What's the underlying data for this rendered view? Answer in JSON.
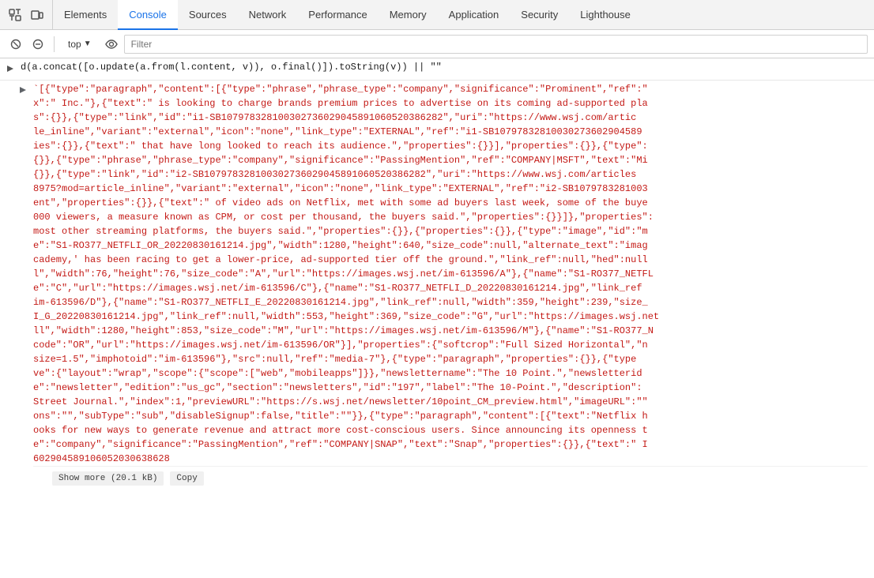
{
  "tabs": {
    "icon1_title": "inspect",
    "icon2_title": "device-toggle",
    "items": [
      {
        "id": "elements",
        "label": "Elements",
        "active": false
      },
      {
        "id": "console",
        "label": "Console",
        "active": true
      },
      {
        "id": "sources",
        "label": "Sources",
        "active": false
      },
      {
        "id": "network",
        "label": "Network",
        "active": false
      },
      {
        "id": "performance",
        "label": "Performance",
        "active": false
      },
      {
        "id": "memory",
        "label": "Memory",
        "active": false
      },
      {
        "id": "application",
        "label": "Application",
        "active": false
      },
      {
        "id": "security",
        "label": "Security",
        "active": false
      },
      {
        "id": "lighthouse",
        "label": "Lighthouse",
        "active": false
      }
    ]
  },
  "console_toolbar": {
    "context_label": "top",
    "filter_placeholder": "Filter"
  },
  "console": {
    "input_prompt": ">",
    "input_text": "d(a.concat([o.update(a.from(l.content, v)), o.final()]).toString(v)) || \"\"",
    "output_prompt": "<",
    "output_text": "`[{\"type\":\"paragraph\",\"content\":[{\"type\":\"phrase\",\"phrase_type\":\"company\",\"significance\":\"Prominent\",\"ref\":\"x\":\" Inc.\"},{\"text\":\" is looking to charge brands premium prices to advertise on its coming ad-supported pla s\":{}},{\"type\":\"link\",\"id\":\"i1-SB107978328100302736029045891060520386282\",\"uri\":\"https://www.wsj.com/artic le_inline\",\"variant\":\"external\",\"icon\":\"none\",\"link_type\":\"EXTERNAL\",\"ref\":\"i1-SB10797832810030273602904589 ies\":{}},{\"text\":\" that have long looked to reach its audience.\",\"properties\":{}}],\"properties\":{}},{\"type\": {}},{\"type\":\"phrase\",\"phrase_type\":\"company\",\"significance\":\"PassingMention\",\"ref\":\"COMPANY|MSFT\",\"text\":\"Mi {}},{\"type\":\"link\",\"id\":\"i2-SB107978328100302736029045891060520386282\",\"uri\":\"https://www.wsj.com/articles 8975?mod=article_inline\",\"variant\":\"external\",\"icon\":\"none\",\"link_type\":\"EXTERNAL\",\"ref\":\"i2-SB1079783281003 ent\",\"properties\":{}},{\"text\":\" of video ads on Netflix, met with some ad buyers last week, some of the buye 000 viewers, a measure known as CPM, or cost per thousand, the buyers said.\",\"properties\":{}}]},\"properties\": most other streaming platforms, the buyers said.\",\"properties\":{}},{\"properties\":{}},{\"type\":\"image\",\"id\":\"m e\":\"S1-RO377_NETFLI_OR_20220830161214.jpg\",\"width\":1280,\"height\":640,\"size_code\":null,\"alternate_text\":\"imag cademy,' has been racing to get a lower-price, ad-supported tier off the ground.\",\"link_ref\":null,\"hed\":null l\",\"width\":76,\"height\":76,\"size_code\":\"A\",\"url\":\"https://images.wsj.net/im-613596/A\"},{\"name\":\"S1-RO377_NETFL e\":\"C\",\"url\":\"https://images.wsj.net/im-613596/C\"},{\"name\":\"S1-RO377_NETFLI_D_20220830161214.jpg\",\"link_ref im-613596/D\"},{\"name\":\"S1-RO377_NETFLI_E_20220830161214.jpg\",\"link_ref\":null,\"width\":359,\"height\":239,\"size_ I_G_20220830161214.jpg\",\"link_ref\":null,\"width\":553,\"height\":369,\"size_code\":\"G\",\"url\":\"https://images.wsj.net ll\",\"width\":1280,\"height\":853,\"size_code\":\"M\",\"url\":\"https://images.wsj.net/im-613596/M\"},{\"name\":\"S1-RO377_N code\":\"OR\",\"url\":\"https://images.wsj.net/im-613596/OR\"}],\"properties\":{\"softcrop\":\"Full Sized Horizontal\",\"n size=1.5\",\"imphotoid\":\"im-613596\"},\"src\":null,\"ref\":\"media-7\"},{\"type\":\"paragraph\",\"properties\":{}},{\"type ve\":{\"layout\":\"wrap\",\"scope\":{\"scope\":[\"web\",\"mobileapps\"]}},\"newslettername\":\"The 10 Point.\",\"newsletterid e\":\"newsletter\",\"edition\":\"us_gc\",\"section\":\"newsletters\",\"id\":\"197\",\"label\":\"The 10-Point.\",\"description\": Street Journal.\",\"index\":1,\"previewURL\":\"https://s.wsj.net/newsletter/10point_CM_preview.html\",\"imageURL\":\"\" ons\":\"\",\"subType\":\"sub\",\"disableSignup\":false,\"title\":\"\"}},{\"type\":\"paragraph\",\"content\":[{\"text\":\"Netflix h ooks for new ways to generate revenue and attract more cost-conscious users. Since announcing its openness t e\":\"company\",\"significance\":\"PassingMention\",\"ref\":\"COMPANY|SNAP\",\"text\":\"Snap\",\"properties\":{}},{\"text\":\" I 602904589106052030638628",
    "show_more_label": "Show more (20.1 kB)",
    "copy_label": "Copy"
  }
}
